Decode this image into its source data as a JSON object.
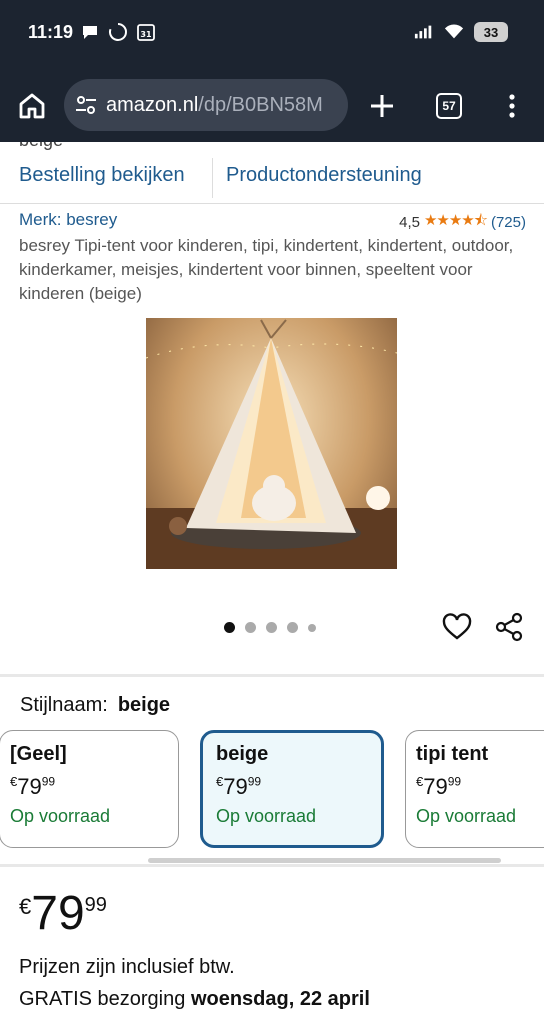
{
  "status_bar": {
    "time": "11:19",
    "calendar_day": "31",
    "battery": "33"
  },
  "browser": {
    "url_domain": "amazon.nl",
    "url_path": "/dp/B0BN58M",
    "tab_count": "57"
  },
  "page": {
    "cut_text": "beige",
    "order_links": {
      "view_order": "Bestelling bekijken",
      "support": "Productondersteuning"
    },
    "brand": "Merk: besrey",
    "rating": {
      "value": "4,5",
      "stars": "★★★★⯪",
      "count": "(725)"
    },
    "title": "besrey Tipi-tent voor kinderen, tipi, kindertent, kindertent, outdoor, kinderkamer, meisjes, kindertent voor binnen, speeltent voor kinderen (beige)",
    "carousel": {
      "dots": 5,
      "active": 0
    },
    "style": {
      "label": "Stijlnaam:",
      "value": "beige"
    },
    "variants": [
      {
        "name": "[Geel]",
        "currency": "€",
        "whole": "79",
        "fraction": "99",
        "stock": "Op voorraad"
      },
      {
        "name": "beige",
        "currency": "€",
        "whole": "79",
        "fraction": "99",
        "stock": "Op voorraad"
      },
      {
        "name": "tipi tent",
        "currency": "€",
        "whole": "79",
        "fraction": "99",
        "stock": "Op voorraad"
      }
    ],
    "price": {
      "currency": "€",
      "whole": "79",
      "fraction": "99"
    },
    "tax_note": "Prijzen zijn inclusief btw.",
    "delivery_prefix": "GRATIS bezorging",
    "delivery_date": "woensdag, 22 april"
  },
  "colors": {
    "status_bg": "#1c2430",
    "link_blue": "#1f5b8e",
    "star_orange": "#e97b12",
    "stock_green": "#1a7b36"
  }
}
